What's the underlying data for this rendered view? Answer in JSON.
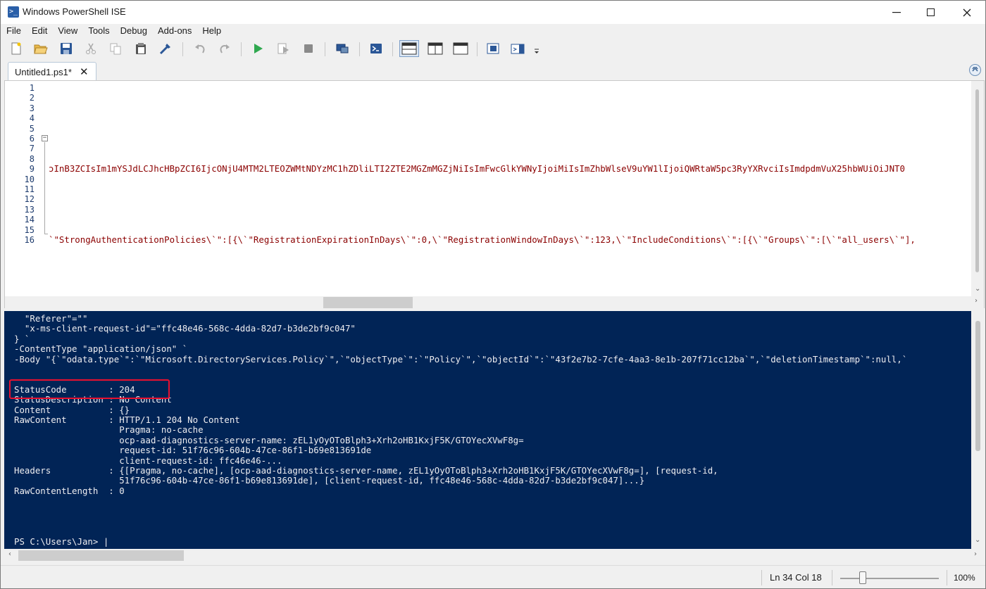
{
  "window": {
    "title": "Windows PowerShell ISE",
    "icon": "powershell-ise-icon"
  },
  "menu": [
    {
      "label": "File"
    },
    {
      "label": "Edit"
    },
    {
      "label": "View"
    },
    {
      "label": "Tools"
    },
    {
      "label": "Debug"
    },
    {
      "label": "Add-ons"
    },
    {
      "label": "Help"
    }
  ],
  "toolbar": {
    "icons": [
      "new-script-icon",
      "open-icon",
      "save-icon",
      "cut-icon",
      "copy-icon",
      "paste-icon",
      "clear-console-icon",
      "undo-icon",
      "redo-icon",
      "run-script-icon",
      "run-selection-icon",
      "stop-icon",
      "new-remote-tab-icon",
      "start-powershell-icon",
      "show-script-top-icon",
      "show-script-right-icon",
      "show-script-maximized-icon",
      "show-command-window-icon",
      "show-command-addon-icon",
      "toolbar-overflow-icon"
    ]
  },
  "tabs": [
    {
      "label": "Untitled1.ps1*",
      "close": "✕"
    }
  ],
  "script": {
    "line_numbers": [
      "1",
      "2",
      "3",
      "4",
      "5",
      "6",
      "7",
      "8",
      "9",
      "10",
      "11",
      "12",
      "13",
      "14",
      "15",
      "16"
    ],
    "line9": "ɔInB3ZCIsIm1mYSJdLCJhcHBpZCI6IjcONjU4MTM2LTEOZWMtNDYzMC1hZDliLTI2ZTE2MGZmMGZjNiIsImFwcGlkYWNyIjoiMiIsImZhbWlseV9uYW1lIjoiQWRtaW5pc3RyYXRvciIsImdpdmVuX25hbWUiOiJNT0",
    "line16": "`\"StrongAuthenticationPolicies\\`\":[{\\`\"RegistrationExpirationInDays\\`\":0,\\`\"RegistrationWindowInDays\\`\":123,\\`\"IncludeConditions\\`\":[{\\`\"Groups\\`\":[\\`\"all_users\\`\"],"
  },
  "console": {
    "lines": [
      "  \"Referer\"=\"\"",
      "  \"x-ms-client-request-id\"=\"ffc48e46-568c-4dda-82d7-b3de2bf9c047\"",
      "} `",
      "-ContentType \"application/json\" `",
      "-Body \"{`\"odata.type`\":`\"Microsoft.DirectoryServices.Policy`\",`\"objectType`\":`\"Policy`\",`\"objectId`\":`\"43f2e7b2-7cfe-4aa3-8e1b-207f71cc12ba`\",`\"deletionTimestamp`\":null,`",
      "",
      "StatusCode        : 204",
      "StatusDescription : No Content",
      "Content           : {}",
      "RawContent        : HTTP/1.1 204 No Content",
      "                    Pragma: no-cache",
      "                    ocp-aad-diagnostics-server-name: zEL1yOyOToBlph3+Xrh2oHB1KxjF5K/GTOYecXVwF8g=",
      "                    request-id: 51f76c96-604b-47ce-86f1-b69e813691de",
      "                    client-request-id: ffc46e46-...",
      "Headers           : {[Pragma, no-cache], [ocp-aad-diagnostics-server-name, zEL1yOyOToBlph3+Xrh2oHB1KxjF5K/GTOYecXVwF8g=], [request-id,",
      "                    51f76c96-604b-47ce-86f1-b69e813691de], [client-request-id, ffc48e46-568c-4dda-82d7-b3de2bf9c047]...}",
      "RawContentLength  : 0"
    ],
    "prompt": "PS C:\\Users\\Jan> |"
  },
  "status": {
    "position": "Ln 34  Col 18",
    "zoom": "100%"
  },
  "colors": {
    "console_bg": "#012456",
    "console_fg": "#eeedf0",
    "string_color": "#8b0000",
    "highlight": "#e8102f"
  }
}
